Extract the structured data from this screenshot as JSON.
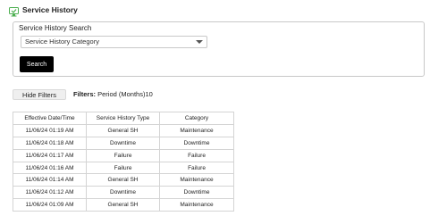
{
  "header": {
    "title": "Service History",
    "icon": "service-history-icon"
  },
  "search_panel": {
    "title": "Service History Search",
    "category_select": {
      "selected": "Service History Category"
    },
    "search_button_label": "Search"
  },
  "filters": {
    "toggle_label": "Hide Filters",
    "summary_label": "Filters:",
    "summary_value": "Period (Months)10"
  },
  "table": {
    "headers": [
      "Effective Date/Time",
      "Service History Type",
      "Category"
    ],
    "rows": [
      [
        "11/06/24 01:19 AM",
        "General SH",
        "Maintenance"
      ],
      [
        "11/06/24 01:18 AM",
        "Downtime",
        "Downtime"
      ],
      [
        "11/06/24 01:17 AM",
        "Failure",
        "Failure"
      ],
      [
        "11/06/24 01:16 AM",
        "Failure",
        "Failure"
      ],
      [
        "11/06/24 01:14 AM",
        "General SH",
        "Maintenance"
      ],
      [
        "11/06/24 01:12 AM",
        "Downtime",
        "Downtime"
      ],
      [
        "11/06/24 01:09 AM",
        "General SH",
        "Maintenance"
      ]
    ]
  },
  "colors": {
    "icon_green": "#4caf50",
    "button_dark": "#000000",
    "border": "#c8c8c8"
  }
}
